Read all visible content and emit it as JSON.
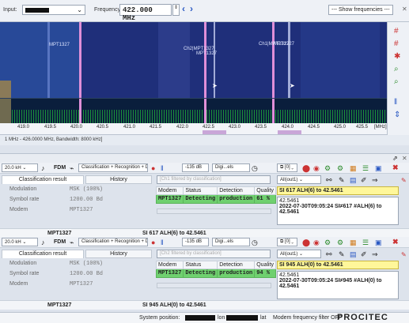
{
  "top": {
    "input_label": "Input:",
    "frequency_label": "Frequency:",
    "frequency_value": "422.000 MHz",
    "show_frequencies": "--- Show frequencies ---"
  },
  "waterfall": {
    "labels": [
      "MPT1327",
      "Ch2|MPT1327",
      "MPT1327",
      "Ch1|MPT1327",
      "MPT1327"
    ]
  },
  "axis": {
    "ticks": [
      "419.0",
      "419.5",
      "420.0",
      "420.5",
      "421.0",
      "421.5",
      "422.0",
      "422.5",
      "423.0",
      "423.5",
      "424.0",
      "424.5",
      "425.0",
      "425.5"
    ],
    "unit": "[MHz]"
  },
  "bandwidth_text": "1 MHz - 426.0000 MHz, Bandwidth: 8000 kHz]",
  "panels": [
    {
      "bw": "20.0 kH",
      "mode": "FDM",
      "classification_mode": "Classification + Recognition + D",
      "level": "-135 dB",
      "digi": "Digi...els",
      "tabs": [
        "Classification result",
        "History"
      ],
      "rows": [
        {
          "key": "Modulation",
          "value": "MSK (100%)"
        },
        {
          "key": "Symbol rate",
          "value": "1200.00 Bd"
        },
        {
          "key": "Modem",
          "value": "MPT1327"
        }
      ],
      "filter_placeholder": "[Ch1 filtered by classification]",
      "det_headers": [
        "Modem",
        "Status",
        "Detection",
        "Quality"
      ],
      "det_row": [
        "MPT1327",
        "Detecting",
        "production",
        "61 %"
      ],
      "out_select": "All(out1)",
      "hl_line": "SI 617 ALH(6) to 42.5461",
      "msg_lines": [
        "42.5461",
        "2022-07-30T09:05:24  SI≠617 #ALH(6) to",
        "42.5461"
      ],
      "footer_modem": "MPT1327",
      "footer_msg": "SI 617 ALH(6) to 42.5461"
    },
    {
      "bw": "20.0 kH",
      "mode": "FDM",
      "classification_mode": "Classification + Recognition + D",
      "level": "-135 dB",
      "digi": "Digi...els",
      "tabs": [
        "Classification result",
        "History"
      ],
      "rows": [
        {
          "key": "Modulation",
          "value": "MSK (100%)"
        },
        {
          "key": "Symbol rate",
          "value": "1200.00 Bd"
        },
        {
          "key": "Modem",
          "value": "MPT1327"
        }
      ],
      "filter_placeholder": "[Ch2 filtered by classification]",
      "det_headers": [
        "Modem",
        "Status",
        "Detection",
        "Quality"
      ],
      "det_row": [
        "MPT1327",
        "Detecting",
        "production",
        "94 %"
      ],
      "out_select": "All(out1)",
      "hl_line": "SI 945 ALH(0) to 42.5461",
      "msg_lines": [
        "42.5461",
        "2022-07-30T09:05:24  SI≠945 #ALH(0) to",
        "42.5461"
      ],
      "footer_modem": "MPT1327",
      "footer_msg": "SI 945 ALH(0) to 42.5461"
    }
  ],
  "statusbar": {
    "system_position": "System position:",
    "lon": "lon",
    "lat": "lat",
    "modem_filter": "Modem frequency filter OFF",
    "brand": "PROCITEC"
  }
}
